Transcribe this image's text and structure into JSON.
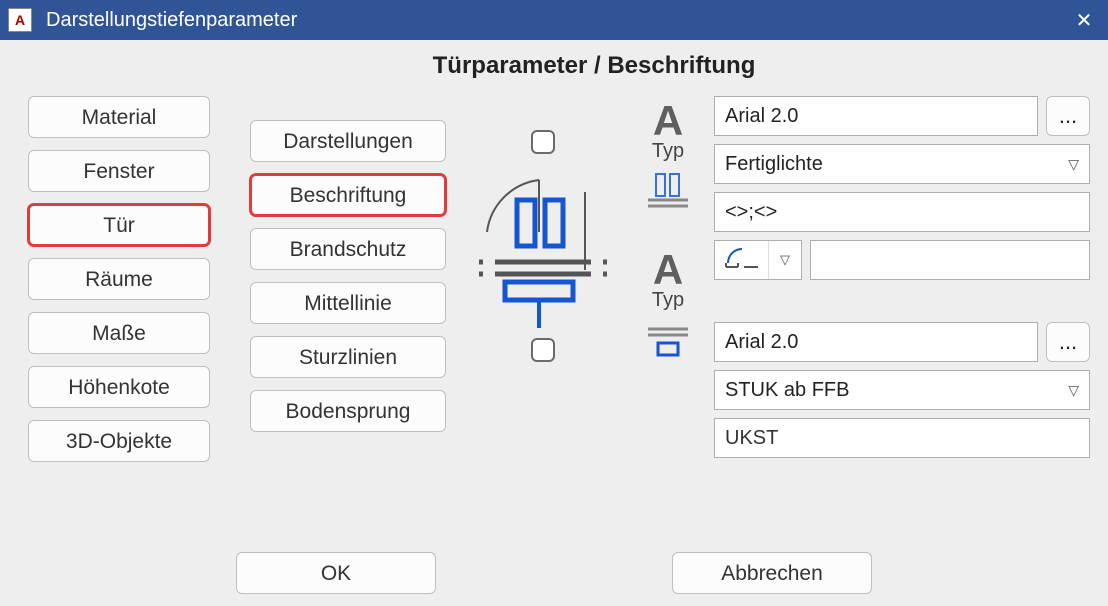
{
  "window": {
    "title": "Darstellungstiefenparameter",
    "app_icon_letter": "A",
    "close_glyph": "✕"
  },
  "page_title": "Türparameter / Beschriftung",
  "sidebar": {
    "items": [
      {
        "label": "Material",
        "highlight": false
      },
      {
        "label": "Fenster",
        "highlight": false
      },
      {
        "label": "Tür",
        "highlight": true
      },
      {
        "label": "Räume",
        "highlight": false
      },
      {
        "label": "Maße",
        "highlight": false
      },
      {
        "label": "Höhenkote",
        "highlight": false
      },
      {
        "label": "3D-Objekte",
        "highlight": false
      }
    ]
  },
  "subtabs": {
    "items": [
      {
        "label": "Darstellungen",
        "highlight": false
      },
      {
        "label": "Beschriftung",
        "highlight": true
      },
      {
        "label": "Brandschutz",
        "highlight": false
      },
      {
        "label": "Mittellinie",
        "highlight": false
      },
      {
        "label": "Sturzlinien",
        "highlight": false
      },
      {
        "label": "Bodensprung",
        "highlight": false
      }
    ]
  },
  "top_group": {
    "big_letter": "A",
    "typ_label": "Typ",
    "checkbox_checked": false,
    "font_value": "Arial 2.0",
    "ellipsis": "...",
    "select_value": "Fertiglichte",
    "expr_value": "<>;<>",
    "blank_value": ""
  },
  "bottom_group": {
    "big_letter": "A",
    "typ_label": "Typ",
    "checkbox_checked": false,
    "font_value": "Arial 2.0",
    "ellipsis": "...",
    "select_value": "STUK ab FFB",
    "readonly_value": "UKST"
  },
  "footer": {
    "ok": "OK",
    "cancel": "Abbrechen"
  }
}
